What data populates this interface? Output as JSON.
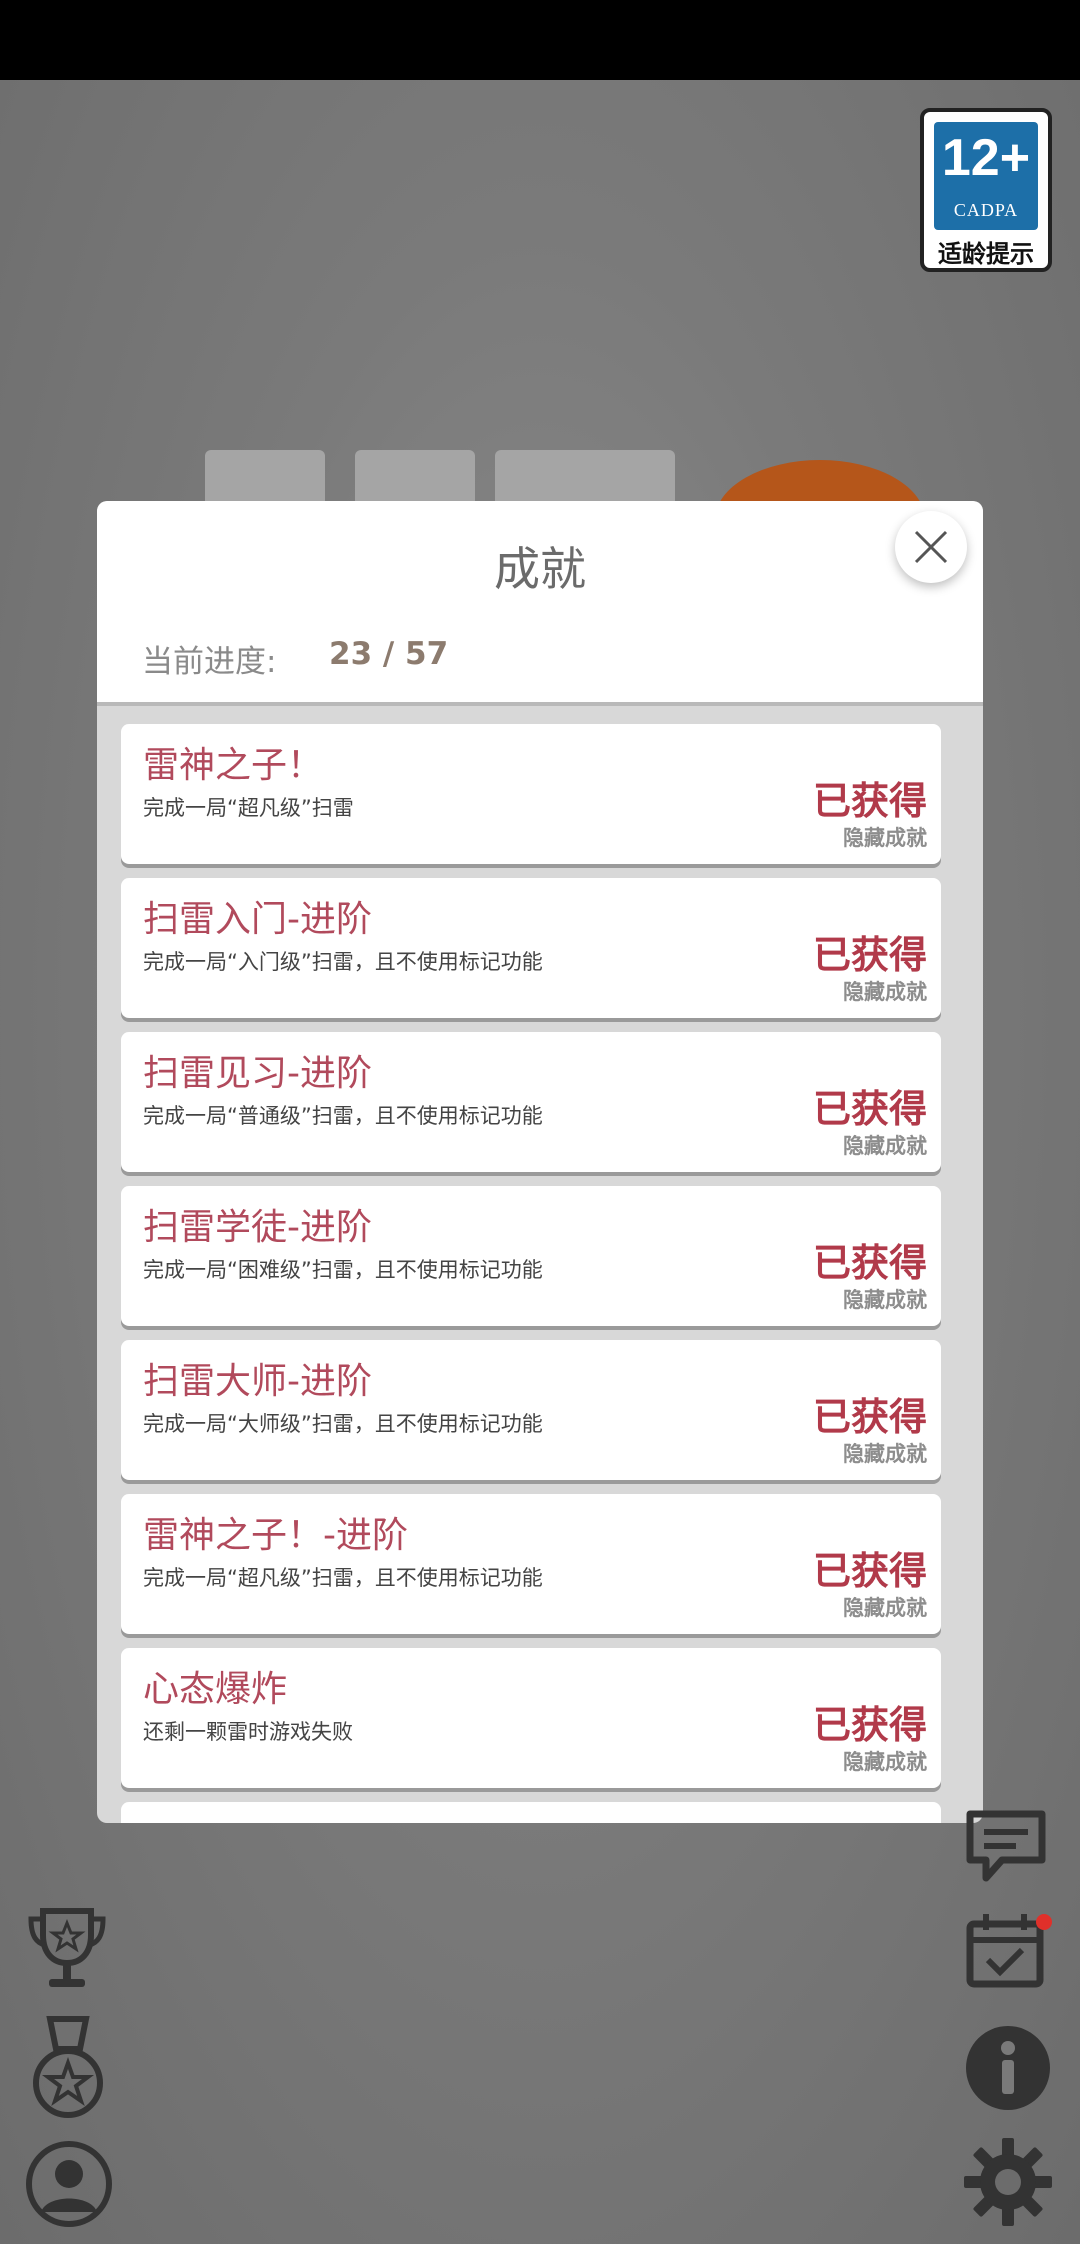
{
  "age_rating": {
    "number": "12+",
    "org": "CADPA",
    "tip": "适龄提示"
  },
  "dialog": {
    "title": "成就",
    "progress_label": "当前进度:",
    "progress_value": "23 / 57",
    "achievements": [
      {
        "title": "雷神之子！",
        "desc": "完成一局“超凡级”扫雷",
        "status": "已获得",
        "tag": "隐藏成就"
      },
      {
        "title": "扫雷入门-进阶",
        "desc": "完成一局“入门级”扫雷，且不使用标记功能",
        "status": "已获得",
        "tag": "隐藏成就"
      },
      {
        "title": "扫雷见习-进阶",
        "desc": "完成一局“普通级”扫雷，且不使用标记功能",
        "status": "已获得",
        "tag": "隐藏成就"
      },
      {
        "title": "扫雷学徒-进阶",
        "desc": "完成一局“困难级”扫雷，且不使用标记功能",
        "status": "已获得",
        "tag": "隐藏成就"
      },
      {
        "title": "扫雷大师-进阶",
        "desc": "完成一局“大师级”扫雷，且不使用标记功能",
        "status": "已获得",
        "tag": "隐藏成就"
      },
      {
        "title": "雷神之子！-进阶",
        "desc": "完成一局“超凡级”扫雷，且不使用标记功能",
        "status": "已获得",
        "tag": "隐藏成就"
      },
      {
        "title": "心态爆炸",
        "desc": "还剩一颗雷时游戏失败",
        "status": "已获得",
        "tag": "隐藏成就"
      }
    ]
  },
  "colors": {
    "title_red": "#b14a5c",
    "status_red": "#b13a4a",
    "progress_brown": "#8c7b6e",
    "notification_dot": "#e0302a"
  },
  "icons": {
    "left": [
      "trophy-icon",
      "medal-icon",
      "profile-icon"
    ],
    "right": [
      "chat-icon",
      "calendar-check-icon",
      "info-icon",
      "gear-icon"
    ]
  }
}
